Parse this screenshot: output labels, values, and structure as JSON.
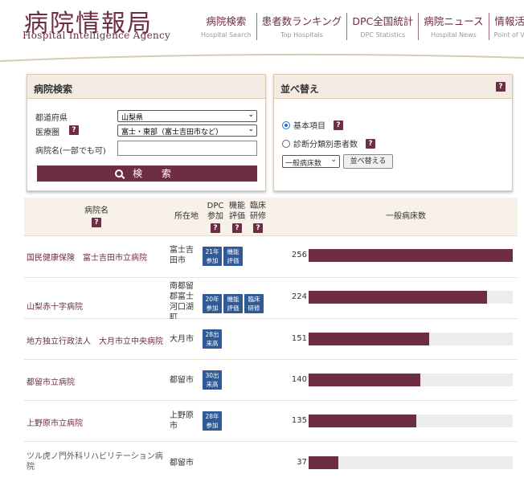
{
  "header": {
    "logo_title": "病院情報局",
    "logo_subtitle": "Hospital Intelligence Agency",
    "nav": [
      {
        "label": "病院検索",
        "sub": "Hospital Search"
      },
      {
        "label": "患者数ランキング",
        "sub": "Top Hospitals"
      },
      {
        "label": "DPC全国統計",
        "sub": "DPC Statistics"
      },
      {
        "label": "病院ニュース",
        "sub": "Hospital News"
      },
      {
        "label": "情報活用",
        "sub": "Point of View"
      }
    ]
  },
  "search": {
    "title": "病院検索",
    "prefecture_label": "都道府県",
    "prefecture_value": "山梨県",
    "region_label": "医療圏",
    "region_value": "富士・東部（富士吉田市など）",
    "name_label": "病院名(一部でも可)",
    "name_value": "",
    "button_label": "検 索"
  },
  "sort": {
    "title": "並べ替え",
    "option_basic": "基本項目",
    "option_diag": "診断分類別患者数",
    "selected_option": "basic",
    "select_value": "一般病床数",
    "button_label": "並べ替える"
  },
  "table": {
    "headers": {
      "name": "病院名",
      "location": "所在地",
      "dpc": "DPC 参加",
      "func": "機能 評価",
      "clinical": "臨床 研修",
      "beds": "一般病床数"
    },
    "max_beds": 256,
    "rows": [
      {
        "name": "国民健康保険　富士吉田市立病院",
        "location": "富士吉田市",
        "badges": [
          "21年 参加",
          "機能 評価"
        ],
        "beds": 256
      },
      {
        "name": "山梨赤十字病院",
        "location": "南都留郡富士河口湖町",
        "badges": [
          "20年 参加",
          "機能 評価",
          "臨床 研修"
        ],
        "beds": 224
      },
      {
        "name": "地方独立行政法人　大月市立中央病院",
        "location": "大月市",
        "badges": [
          "28出 来高"
        ],
        "beds": 151
      },
      {
        "name": "都留市立病院",
        "location": "都留市",
        "badges": [
          "30出 来高"
        ],
        "beds": 140
      },
      {
        "name": "上野原市立病院",
        "location": "上野原市",
        "badges": [
          "28年 参加"
        ],
        "beds": 135
      },
      {
        "name": "ツル虎ノ門外科リハビリテーション病院",
        "location": "都留市",
        "badges": [],
        "beds": 37
      }
    ]
  },
  "colors": {
    "brand": "#6e2c45",
    "badge": "#2f5a96",
    "panel_head": "#f3ebe1"
  }
}
